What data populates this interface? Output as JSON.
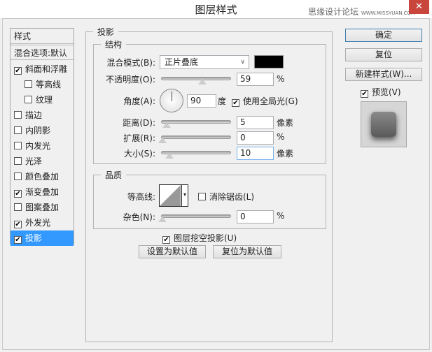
{
  "window": {
    "title": "图层样式",
    "watermark_cn": "思缘设计论坛",
    "watermark_url": "WWW.MISSYUAN.COM",
    "close": "✕"
  },
  "sidebar": {
    "header": "样式",
    "blend": "混合选项:默认",
    "items": [
      {
        "label": "斜面和浮雕",
        "checked": true,
        "indent": false
      },
      {
        "label": "等高线",
        "checked": false,
        "indent": true
      },
      {
        "label": "纹理",
        "checked": false,
        "indent": true
      },
      {
        "label": "描边",
        "checked": false,
        "indent": false
      },
      {
        "label": "内阴影",
        "checked": false,
        "indent": false
      },
      {
        "label": "内发光",
        "checked": false,
        "indent": false
      },
      {
        "label": "光泽",
        "checked": false,
        "indent": false
      },
      {
        "label": "颜色叠加",
        "checked": false,
        "indent": false
      },
      {
        "label": "渐变叠加",
        "checked": true,
        "indent": false
      },
      {
        "label": "图案叠加",
        "checked": false,
        "indent": false
      },
      {
        "label": "外发光",
        "checked": true,
        "indent": false
      },
      {
        "label": "投影",
        "checked": true,
        "indent": false,
        "selected": true
      }
    ]
  },
  "main": {
    "title": "投影",
    "structure": {
      "title": "结构",
      "blend_mode_label": "混合模式(B):",
      "blend_mode": "正片叠底",
      "color": "#000000",
      "opacity_label": "不透明度(O):",
      "opacity": "59",
      "opacity_unit": "%",
      "angle_label": "角度(A):",
      "angle": "90",
      "angle_unit": "度",
      "global_light": "使用全局光(G)",
      "distance_label": "距离(D):",
      "distance": "5",
      "distance_unit": "像素",
      "spread_label": "扩展(R):",
      "spread": "0",
      "spread_unit": "%",
      "size_label": "大小(S):",
      "size": "10",
      "size_unit": "像素"
    },
    "quality": {
      "title": "品质",
      "contour_label": "等高线:",
      "antialias": "消除锯齿(L)",
      "noise_label": "杂色(N):",
      "noise": "0",
      "noise_unit": "%"
    },
    "knockout": "图层挖空投影(U)",
    "make_default": "设置为默认值",
    "reset_default": "复位为默认值"
  },
  "buttons": {
    "ok": "确定",
    "reset": "复位",
    "new_style": "新建样式(W)...",
    "preview": "预览(V)"
  }
}
